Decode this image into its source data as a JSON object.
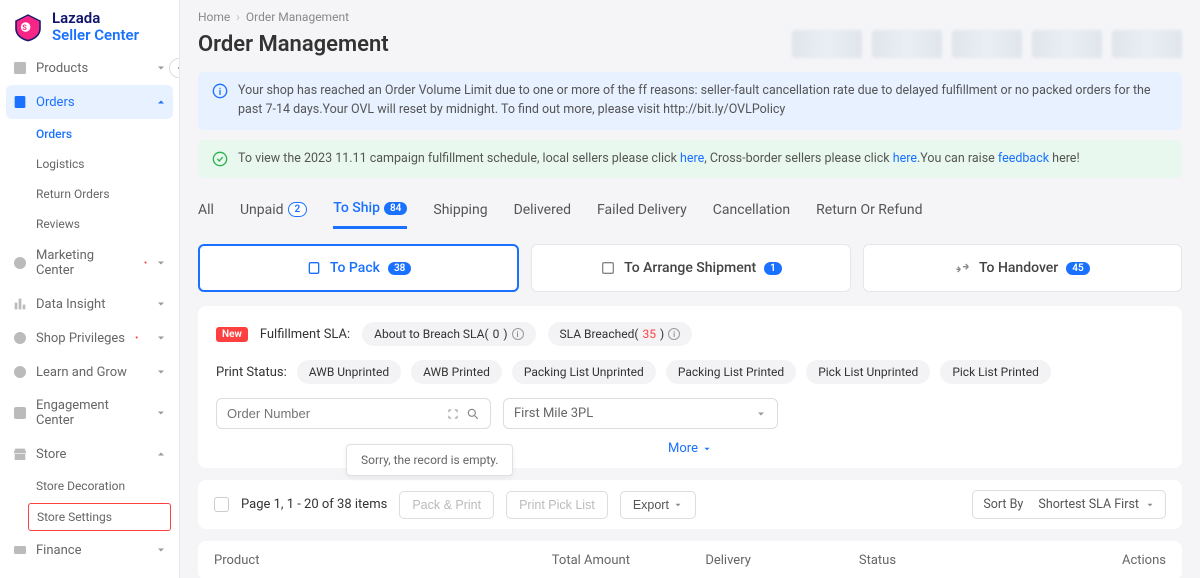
{
  "logo": {
    "line1": "Lazada",
    "line2": "Seller Center"
  },
  "nav": {
    "products": "Products",
    "orders": "Orders",
    "orders_sub": [
      "Orders",
      "Logistics",
      "Return Orders",
      "Reviews"
    ],
    "marketing": "Marketing Center",
    "data_insight": "Data Insight",
    "shop_priv": "Shop Privileges",
    "learn": "Learn and Grow",
    "engagement": "Engagement Center",
    "store": "Store",
    "store_sub": [
      "Store Decoration",
      "Store Settings"
    ],
    "finance": "Finance"
  },
  "breadcrumb": [
    "Home",
    "Order Management"
  ],
  "title": "Order Management",
  "alerts": {
    "ovl": "Your shop has reached an Order Volume Limit due to one or more of the ff reasons: seller-fault cancellation rate due to delayed fulfillment or no packed orders for the past 7-14 days.Your OVL will reset by midnight. To find out more, please visit http://bit.ly/OVLPolicy",
    "campaign_pre": "To view the 2023 11.11 campaign fulfillment schedule, local sellers please click ",
    "here": "here",
    "campaign_mid": ", Cross-border sellers please click ",
    "campaign_post1": ".You can raise ",
    "feedback": "feedback",
    "campaign_post2": " here!"
  },
  "tabs": {
    "all": "All",
    "unpaid": "Unpaid",
    "unpaid_n": "2",
    "toship": "To Ship",
    "toship_n": "84",
    "shipping": "Shipping",
    "delivered": "Delivered",
    "failed": "Failed Delivery",
    "cancel": "Cancellation",
    "return": "Return Or Refund"
  },
  "subtabs": {
    "pack": "To Pack",
    "pack_n": "38",
    "arrange": "To Arrange Shipment",
    "arrange_n": "1",
    "handover": "To Handover",
    "handover_n": "45"
  },
  "sla": {
    "new": "New",
    "label": "Fulfillment SLA:",
    "about": "About to Breach SLA(",
    "about_n": "0",
    "about2": ")",
    "breached": "SLA Breached(",
    "breached_n": "35",
    "breached2": ")"
  },
  "print": {
    "label": "Print Status:",
    "opts": [
      "AWB Unprinted",
      "AWB Printed",
      "Packing List Unprinted",
      "Packing List Printed",
      "Pick List Unprinted",
      "Pick List Printed"
    ]
  },
  "search": {
    "order_placeholder": "Order Number",
    "fm3pl": "First Mile 3PL"
  },
  "more": "More",
  "empty": "Sorry, the record is empty.",
  "toolbar": {
    "page": "Page 1, 1 - 20 of 38 items",
    "pack_print": "Pack & Print",
    "print_pick": "Print Pick List",
    "export": "Export",
    "sort_label": "Sort By",
    "sort_val": "Shortest SLA First"
  },
  "cols": [
    "Product",
    "Total Amount",
    "Delivery",
    "Status",
    "Actions"
  ]
}
